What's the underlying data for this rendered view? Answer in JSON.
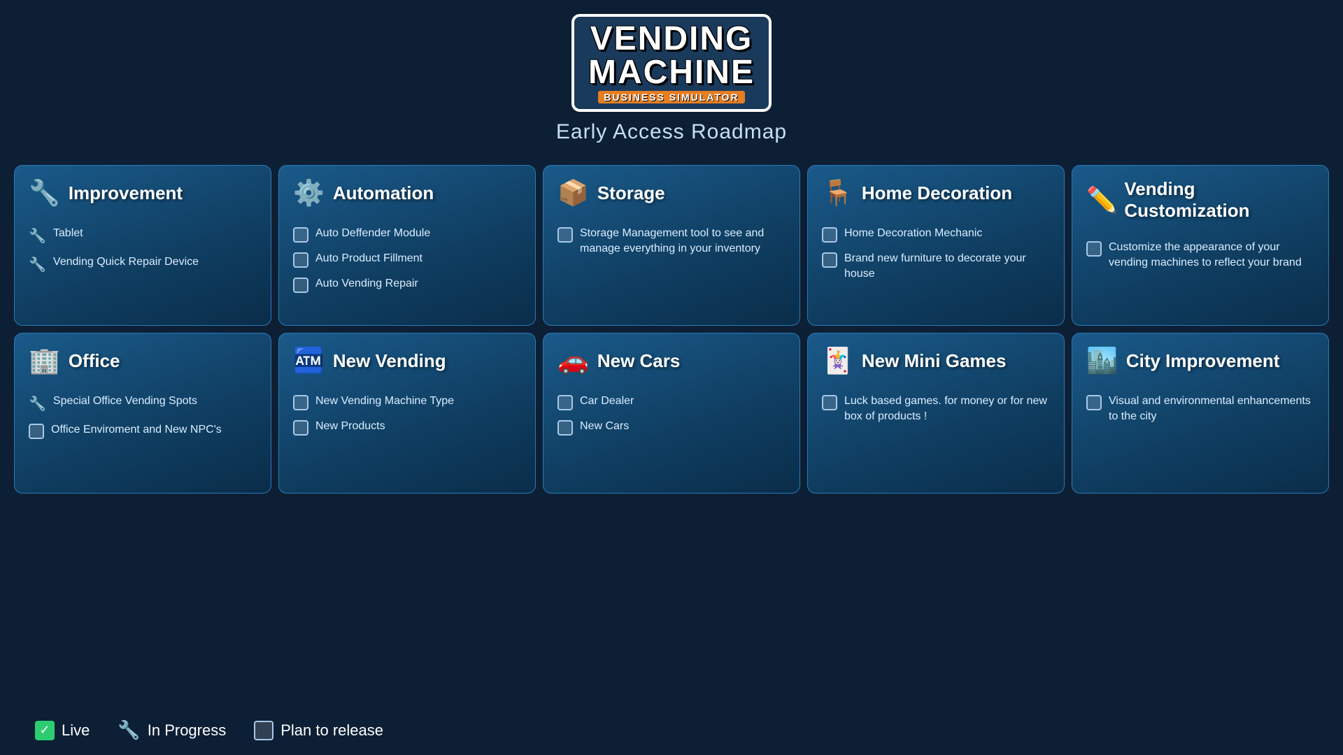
{
  "header": {
    "logo_line1": "VENDING",
    "logo_line2": "MACHINE",
    "logo_sub": "BUSINESS SIMULATOR",
    "tagline": "Early Access Roadmap"
  },
  "rows": [
    {
      "cards": [
        {
          "id": "improvement",
          "icon": "🔧",
          "title": "Improvement",
          "items": [
            {
              "icon": "wrench",
              "text": "Tablet",
              "type": "wrench"
            },
            {
              "icon": "wrench",
              "text": "Vending Quick Repair Device",
              "type": "wrench"
            }
          ]
        },
        {
          "id": "automation",
          "icon": "⚙️",
          "title": "Automation",
          "items": [
            {
              "icon": "checkbox",
              "text": "Auto Deffender Module",
              "type": "checkbox"
            },
            {
              "icon": "checkbox",
              "text": "Auto Product Fillment",
              "type": "checkbox"
            },
            {
              "icon": "checkbox",
              "text": "Auto Vending Repair",
              "type": "checkbox"
            }
          ]
        },
        {
          "id": "storage",
          "icon": "📦",
          "title": "Storage",
          "items": [
            {
              "icon": "checkbox",
              "text": "Storage Management tool to see and manage everything in your inventory",
              "type": "checkbox"
            }
          ]
        },
        {
          "id": "home-decoration",
          "icon": "🪑",
          "title": "Home Decoration",
          "items": [
            {
              "icon": "checkbox",
              "text": "Home Decoration Mechanic",
              "type": "checkbox"
            },
            {
              "icon": "checkbox",
              "text": "Brand new furniture to decorate your house",
              "type": "checkbox"
            }
          ]
        },
        {
          "id": "vending-customization",
          "icon": "✏️",
          "title": "Vending Customization",
          "items": [
            {
              "icon": "checkbox",
              "text": "Customize the appearance of your vending machines to reflect your brand",
              "type": "checkbox"
            }
          ]
        }
      ]
    },
    {
      "cards": [
        {
          "id": "office",
          "icon": "🏢",
          "title": "Office",
          "items": [
            {
              "icon": "wrench",
              "text": "Special Office Vending Spots",
              "type": "wrench"
            },
            {
              "icon": "checkbox",
              "text": "Office Enviroment and New NPC's",
              "type": "checkbox"
            }
          ]
        },
        {
          "id": "new-vending",
          "icon": "🏧",
          "title": "New Vending",
          "items": [
            {
              "icon": "checkbox",
              "text": "New Vending Machine Type",
              "type": "checkbox"
            },
            {
              "icon": "checkbox",
              "text": "New Products",
              "type": "checkbox"
            }
          ]
        },
        {
          "id": "new-cars",
          "icon": "🚗",
          "title": "New Cars",
          "items": [
            {
              "icon": "checkbox",
              "text": "Car Dealer",
              "type": "checkbox"
            },
            {
              "icon": "checkbox",
              "text": "New Cars",
              "type": "checkbox"
            }
          ]
        },
        {
          "id": "new-mini-games",
          "icon": "🃏",
          "title": "New Mini Games",
          "items": [
            {
              "icon": "checkbox",
              "text": "Luck based games. for money or for new box of products !",
              "type": "checkbox"
            }
          ]
        },
        {
          "id": "city-improvement",
          "icon": "🏙️",
          "title": "City Improvement",
          "items": [
            {
              "icon": "checkbox",
              "text": "Visual and environmental enhancements to the city",
              "type": "checkbox"
            }
          ]
        }
      ]
    }
  ],
  "legend": {
    "live_label": "Live",
    "in_progress_label": "In Progress",
    "plan_label": "Plan to release"
  }
}
